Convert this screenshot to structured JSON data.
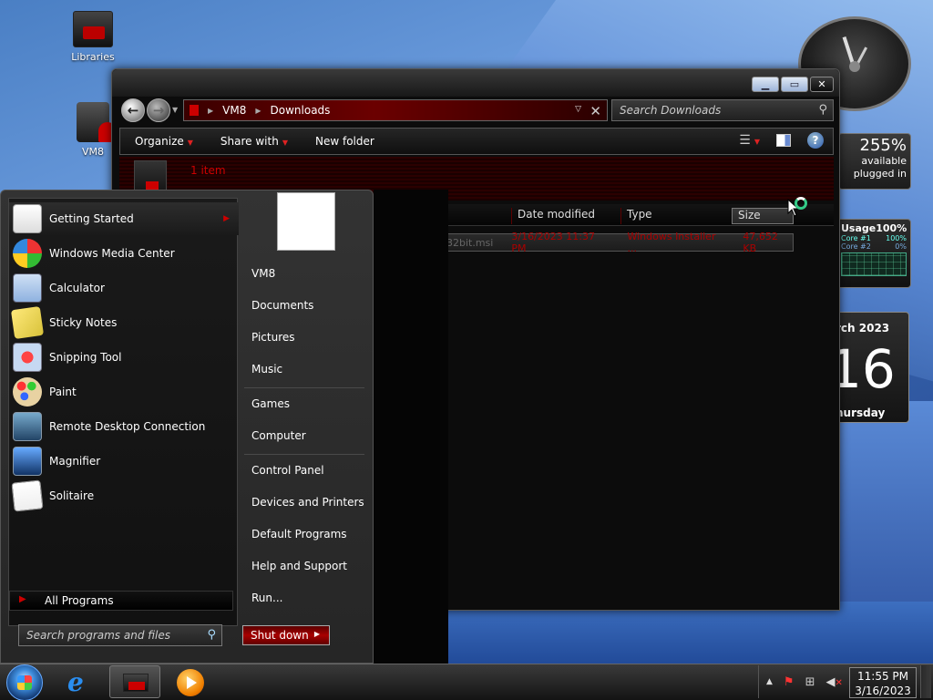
{
  "desktop": {
    "icons": [
      {
        "label": "Libraries"
      },
      {
        "label": "VM8"
      }
    ]
  },
  "gadgets": {
    "battery": {
      "percent": "255%",
      "line1": "available",
      "line2": "plugged in"
    },
    "cpu": {
      "title": "Usage",
      "total": "100%",
      "core1_label": "Core #1",
      "core1_value": "100%",
      "core2_label": "Core #2",
      "core2_value": "0%"
    },
    "calendar": {
      "month": "rch 2023",
      "day": "16",
      "weekday": "hursday"
    }
  },
  "explorer": {
    "path": [
      "VM8",
      "Downloads"
    ],
    "search_placeholder": "Search Downloads",
    "toolbar": {
      "organize": "Organize",
      "share_with": "Share with",
      "new_folder": "New folder"
    },
    "item_count": "1 item",
    "columns": {
      "date": "Date modified",
      "type": "Type",
      "size": "Size"
    },
    "file": {
      "name": "32bit.msi",
      "date": "3/16/2023 11:37 PM",
      "type": "Windows Installer ...",
      "size": "47,652 KB"
    }
  },
  "start_menu": {
    "programs": [
      {
        "label": "Getting Started",
        "icon": "getting-started-icon"
      },
      {
        "label": "Windows Media Center",
        "icon": "windows-media-center-icon"
      },
      {
        "label": "Calculator",
        "icon": "calculator-icon"
      },
      {
        "label": "Sticky Notes",
        "icon": "sticky-notes-icon"
      },
      {
        "label": "Snipping Tool",
        "icon": "snipping-tool-icon"
      },
      {
        "label": "Paint",
        "icon": "paint-icon"
      },
      {
        "label": "Remote Desktop Connection",
        "icon": "remote-desktop-icon"
      },
      {
        "label": "Magnifier",
        "icon": "magnifier-icon"
      },
      {
        "label": "Solitaire",
        "icon": "solitaire-icon"
      }
    ],
    "all_programs": "All Programs",
    "search_placeholder": "Search programs and files",
    "right_links": [
      "VM8",
      "Documents",
      "Pictures",
      "Music",
      "Games",
      "Computer",
      "Control Panel",
      "Devices and Printers",
      "Default Programs",
      "Help and Support",
      "Run..."
    ],
    "shutdown": "Shut down"
  },
  "taskbar": {
    "time": "11:55 PM",
    "date": "3/16/2023"
  },
  "colors": {
    "accent_red": "#c00000",
    "window_bg": "#0c0c0c"
  }
}
